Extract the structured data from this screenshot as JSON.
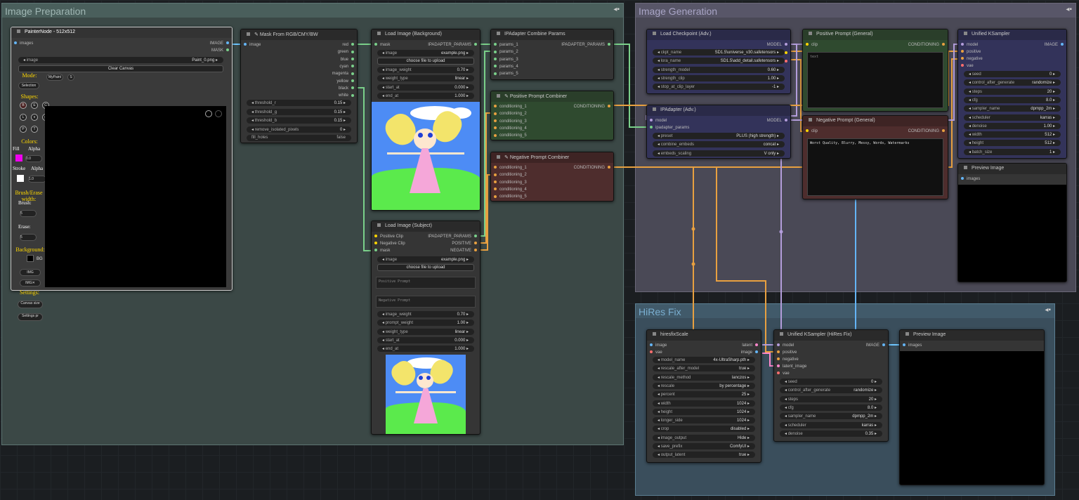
{
  "colors": {
    "accent": "#e8a040",
    "model": "#b39ddb",
    "clip": "#ffd500",
    "vae": "#ff6e6e",
    "image": "#64b5f6"
  },
  "groups": {
    "prep": "Image Preparation",
    "gen": "Image Generation",
    "hires": "HiRes Fix",
    "pin_icon": "◂▪"
  },
  "painter": {
    "title": "PainterNode - 512x512",
    "in_images": "images",
    "out_image": "IMAGE",
    "out_mask": "MASK",
    "image_label": "image",
    "image_value": "Paint_0.png",
    "clear": "Clear Canvas",
    "mode": "Mode:",
    "mypaint": "MyPaint",
    "mypaint_badge": "S",
    "selection": "Selection",
    "shapes": "Shapes:",
    "shape_icons": [
      "B",
      "E",
      "C",
      "L",
      "∨",
      "◻",
      "P",
      "T"
    ],
    "colors": "Colors:",
    "fill": "Fill",
    "alpha": "Alpha",
    "fill_alpha": "0.0",
    "stroke": "Stroke",
    "stroke_alpha": "1.0",
    "brush_erase": "Brush/Erase width:",
    "brush": "Brush:",
    "brush_v": "5",
    "erase": "Erase:",
    "erase_v": "5",
    "background": "Background:",
    "bg": "BG",
    "img1": "IMG",
    "img2": "IMG✕",
    "settings": "Settings:",
    "canvas_size": "Canvas size",
    "settings_btn": "Settings pr"
  },
  "mask": {
    "title": "Mask From RGB/CMY/BW",
    "in_image": "image",
    "outs": [
      "red",
      "green",
      "blue",
      "cyan",
      "magenta",
      "yellow",
      "black",
      "white"
    ],
    "widgets": [
      [
        "threshold_r",
        "0.15"
      ],
      [
        "threshold_g",
        "0.15"
      ],
      [
        "threshold_b",
        "0.15"
      ],
      [
        "remove_isolated_pixels",
        "0"
      ]
    ],
    "fill_label": "fill_holes",
    "fill_value": "false"
  },
  "loadbg": {
    "title": "Load Image (Background)",
    "in_mask": "mask",
    "out": "IPADAPTER_PARAMS",
    "widgets": [
      [
        "image",
        "example.png"
      ]
    ],
    "upload": "choose file to upload",
    "params": [
      [
        "image_weight",
        "0.70"
      ],
      [
        "weight_type",
        "linear"
      ],
      [
        "start_at",
        "0.000"
      ],
      [
        "end_at",
        "1.000"
      ]
    ]
  },
  "loadsub": {
    "title": "Load Image (Subject)",
    "ins": [
      "Positive Clip",
      "Negative Clip",
      "mask"
    ],
    "outs": [
      "IPADAPTER_PARAMS",
      "POSITIVE",
      "NEGATIVE"
    ],
    "image": [
      "image",
      "example.png"
    ],
    "upload": "choose file to upload",
    "pos_ph": "Positive Prompt",
    "neg_ph": "Negative Prompt",
    "params": [
      [
        "image_weight",
        "0.70"
      ],
      [
        "prompt_weight",
        "1.00"
      ],
      [
        "weight_type",
        "linear"
      ],
      [
        "start_at",
        "0.000"
      ],
      [
        "end_at",
        "1.000"
      ]
    ]
  },
  "combparams": {
    "title": "IPAdapter Combine Params",
    "ins": [
      "params_1",
      "params_2",
      "params_3",
      "params_4",
      "params_5"
    ],
    "out": "IPADAPTER_PARAMS"
  },
  "poscomb": {
    "title": "Positive Prompt Combiner",
    "ins": [
      "conditioning_1",
      "conditioning_2",
      "conditioning_3",
      "conditioning_4",
      "conditioning_5"
    ],
    "out": "CONDITIONING"
  },
  "negcomb": {
    "title": "Negative Prompt Combiner",
    "ins": [
      "conditioning_1",
      "conditioning_2",
      "conditioning_3",
      "conditioning_4",
      "conditioning_5"
    ],
    "out": "CONDITIONING"
  },
  "ckpt": {
    "title": "Load Checkpoint (Adv.)",
    "outs": [
      "MODEL",
      "CLIP",
      "VAE"
    ],
    "widgets": [
      [
        "ckpt_name",
        "SD1.5\\universe_v30.safetensors"
      ],
      [
        "lora_name",
        "SD1.5\\add_detail.safetensors"
      ],
      [
        "strength_model",
        "0.60"
      ],
      [
        "strength_clip",
        "1.00"
      ],
      [
        "stop_at_clip_layer",
        "-1"
      ]
    ]
  },
  "ipadv": {
    "title": "IPAdapter (Adv.)",
    "ins": [
      "model",
      "ipadapter_params"
    ],
    "out": "MODEL",
    "widgets": [
      [
        "preset",
        "PLUS (high strength)"
      ],
      [
        "combine_embeds",
        "concat"
      ],
      [
        "embeds_scaling",
        "V only"
      ]
    ]
  },
  "posgen": {
    "title": "Positive Prompt (General)",
    "in": "clip",
    "out": "CONDITIONING",
    "ph": "text"
  },
  "neggen": {
    "title": "Negative Prompt (General)",
    "in": "clip",
    "out": "CONDITIONING",
    "text": "Worst Quality, Blurry, Messy, Words, Watermarks"
  },
  "ksampler": {
    "title": "Unified KSampler",
    "ins": [
      "model",
      "positive",
      "negative",
      "vae"
    ],
    "out": "IMAGE",
    "widgets": [
      [
        "seed",
        "0"
      ],
      [
        "control_after_generate",
        "randomize"
      ],
      [
        "steps",
        "20"
      ],
      [
        "cfg",
        "8.0"
      ],
      [
        "sampler_name",
        "dpmpp_2m"
      ],
      [
        "scheduler",
        "karras"
      ],
      [
        "denoise",
        "1.00"
      ],
      [
        "width",
        "512"
      ],
      [
        "height",
        "512"
      ],
      [
        "batch_size",
        "1"
      ]
    ]
  },
  "preview1": {
    "title": "Preview Image",
    "in": "images"
  },
  "hiresscale": {
    "title": "hiresfixScale",
    "ins": [
      "image",
      "vae"
    ],
    "outs": [
      "latent",
      "image"
    ],
    "widgets": [
      [
        "model_name",
        "4x-UltraSharp.pth"
      ],
      [
        "rescale_after_model",
        "true"
      ],
      [
        "rescale_method",
        "lanczos"
      ],
      [
        "rescale",
        "by percentage"
      ],
      [
        "percent",
        "25"
      ],
      [
        "width",
        "1024"
      ],
      [
        "height",
        "1024"
      ],
      [
        "longer_side",
        "1024"
      ],
      [
        "crop",
        "disabled"
      ],
      [
        "image_output",
        "Hide"
      ],
      [
        "save_prefix",
        "ComfyUI"
      ],
      [
        "output_latent",
        "true"
      ]
    ]
  },
  "ksampler2": {
    "title": "Unified KSampler (HiRes Fix)",
    "ins": [
      "model",
      "positive",
      "negative",
      "latent_image",
      "vae"
    ],
    "out": "IMAGE",
    "widgets": [
      [
        "seed",
        "0"
      ],
      [
        "control_after_generate",
        "randomize"
      ],
      [
        "steps",
        "20"
      ],
      [
        "cfg",
        "8.0"
      ],
      [
        "sampler_name",
        "dpmpp_2m"
      ],
      [
        "scheduler",
        "karras"
      ],
      [
        "denoise",
        "0.35"
      ]
    ]
  },
  "preview2": {
    "title": "Preview Image",
    "in": "images"
  }
}
